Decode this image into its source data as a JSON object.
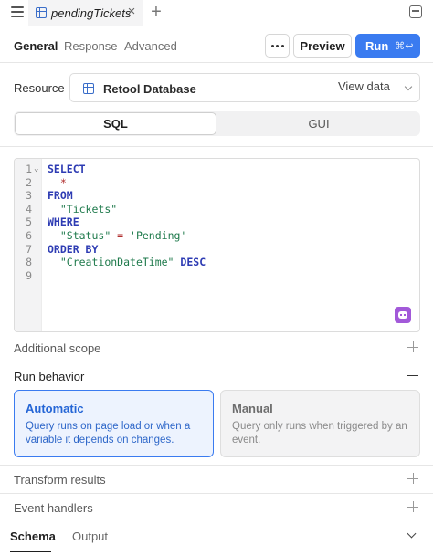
{
  "tab": {
    "title": "pendingTickets"
  },
  "header": {
    "subtabs": [
      "General",
      "Response",
      "Advanced"
    ],
    "preview_label": "Preview",
    "run_label": "Run",
    "run_shortcut": "⌘↩"
  },
  "resource": {
    "label": "Resource",
    "value": "Retool Database",
    "view_data": "View data"
  },
  "mode": {
    "sql": "SQL",
    "gui": "GUI"
  },
  "editor": {
    "lines": [
      {
        "n": "1",
        "text": "SELECT",
        "kind": "kw",
        "indent": ""
      },
      {
        "n": "2",
        "text": "*",
        "kind": "op",
        "indent": "  "
      },
      {
        "n": "3",
        "text": "FROM",
        "kind": "kw",
        "indent": ""
      },
      {
        "n": "4",
        "text": "\"Tickets\"",
        "kind": "str",
        "indent": "  "
      },
      {
        "n": "5",
        "text": "WHERE",
        "kind": "kw",
        "indent": ""
      },
      {
        "n": "6",
        "parts": [
          {
            "t": "\"Status\"",
            "k": "str"
          },
          {
            "t": " = ",
            "k": "op"
          },
          {
            "t": "'Pending'",
            "k": "str"
          }
        ],
        "indent": "  "
      },
      {
        "n": "7",
        "text": "ORDER BY",
        "kind": "kw",
        "indent": ""
      },
      {
        "n": "8",
        "parts": [
          {
            "t": "\"CreationDateTime\"",
            "k": "str"
          },
          {
            "t": " ",
            "k": ""
          },
          {
            "t": "DESC",
            "k": "kw"
          }
        ],
        "indent": "  "
      },
      {
        "n": "9",
        "text": "",
        "kind": "",
        "indent": ""
      }
    ]
  },
  "sections": {
    "additional_scope": "Additional scope",
    "run_behavior": "Run behavior",
    "transform_results": "Transform results",
    "event_handlers": "Event handlers"
  },
  "run_behavior": {
    "automatic": {
      "title": "Automatic",
      "description": "Query runs on page load or when a variable it depends on changes.",
      "selected": true
    },
    "manual": {
      "title": "Manual",
      "description": "Query only runs when triggered by an event.",
      "selected": false
    }
  },
  "bottom_tabs": {
    "schema": "Schema",
    "output": "Output"
  },
  "colors": {
    "accent": "#3a7bf0",
    "ai": "#a259d9"
  }
}
